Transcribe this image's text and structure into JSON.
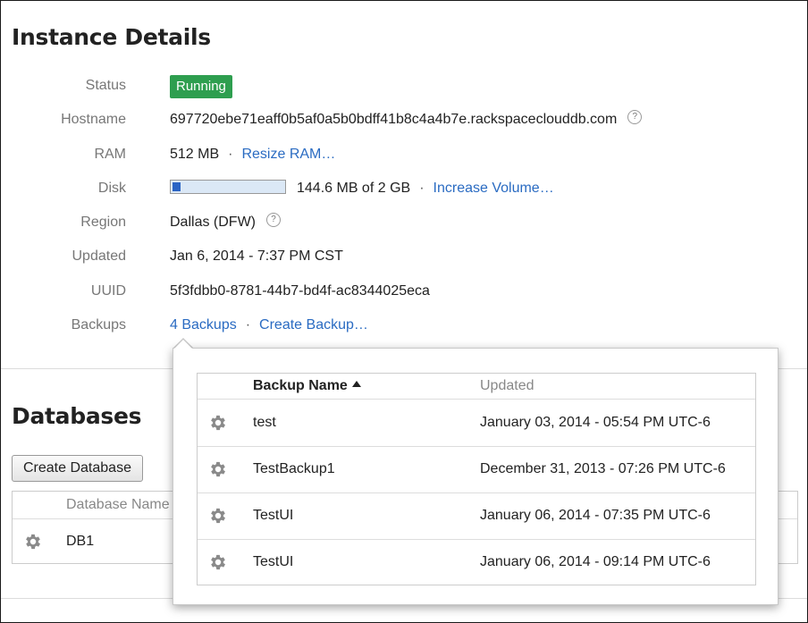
{
  "instance": {
    "title": "Instance Details",
    "status_label": "Status",
    "status_value": "Running",
    "hostname_label": "Hostname",
    "hostname_value": "697720ebe71eaff0b5af0a5b0bdff41b8c4a4b7e.rackspaceclouddb.com",
    "ram_label": "RAM",
    "ram_value": "512 MB",
    "ram_link": "Resize RAM…",
    "disk_label": "Disk",
    "disk_used_fraction": 0.07,
    "disk_value": "144.6 MB of 2 GB",
    "disk_link": "Increase Volume…",
    "region_label": "Region",
    "region_value": "Dallas (DFW)",
    "updated_label": "Updated",
    "updated_value": "Jan 6, 2014 - 7:37 PM CST",
    "uuid_label": "UUID",
    "uuid_value": "5f3fdbb0-8781-44b7-bd4f-ac8344025eca",
    "backups_label": "Backups",
    "backups_link": "4 Backups",
    "create_backup_link": "Create Backup…",
    "separator": "·",
    "help_glyph": "?"
  },
  "databases": {
    "title": "Databases",
    "create_button": "Create Database",
    "column_name": "Database Name",
    "rows": [
      {
        "name": "DB1"
      }
    ]
  },
  "backups_popover": {
    "column_name": "Backup Name",
    "column_updated": "Updated",
    "sort": "ascending",
    "rows": [
      {
        "name": "test",
        "updated": "January 03, 2014 - 05:54 PM UTC-6"
      },
      {
        "name": "TestBackup1",
        "updated": "December 31, 2013 - 07:26 PM UTC-6"
      },
      {
        "name": "TestUI",
        "updated": "January 06, 2014 - 07:35 PM UTC-6"
      },
      {
        "name": "TestUI",
        "updated": "January 06, 2014 - 09:14 PM UTC-6"
      }
    ]
  },
  "colors": {
    "status_running": "#2e9e4f",
    "link": "#2a6bc2",
    "disk_fill": "#2a64c4",
    "disk_track": "#dbe8f6",
    "gear": "#8a8a8a"
  },
  "icons": {
    "gear": "gear-icon",
    "help": "help-icon",
    "sort": "sort-ascending-icon"
  }
}
